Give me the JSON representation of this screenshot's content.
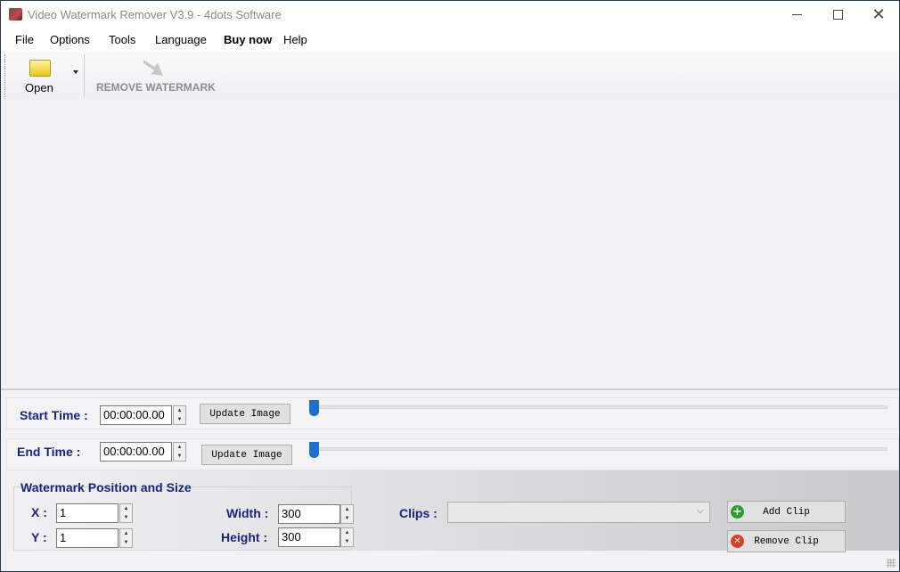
{
  "window": {
    "title": "Video Watermark Remover V3.9 - 4dots Software"
  },
  "menu": [
    "File",
    "Options",
    "Tools",
    "Language",
    "Buy now",
    "Help"
  ],
  "toolbar": {
    "open": "Open",
    "remove": "REMOVE WATERMARK"
  },
  "start": {
    "label": "Start Time :",
    "value": "00:00:00.00",
    "button": "Update Image",
    "slider": 0
  },
  "end": {
    "label": "End Time :",
    "value": "00:00:00.00",
    "button": "Update Image",
    "slider": 0
  },
  "wm": {
    "title": "Watermark Position and Size",
    "x_label": "X :",
    "x": "1",
    "y_label": "Y :",
    "y": "1",
    "w_label": "Width :",
    "w": "300",
    "h_label": "Height :",
    "h": "300",
    "clips_label": "Clips :",
    "clips_value": "",
    "add": "Add Clip",
    "remove": "Remove Clip"
  }
}
